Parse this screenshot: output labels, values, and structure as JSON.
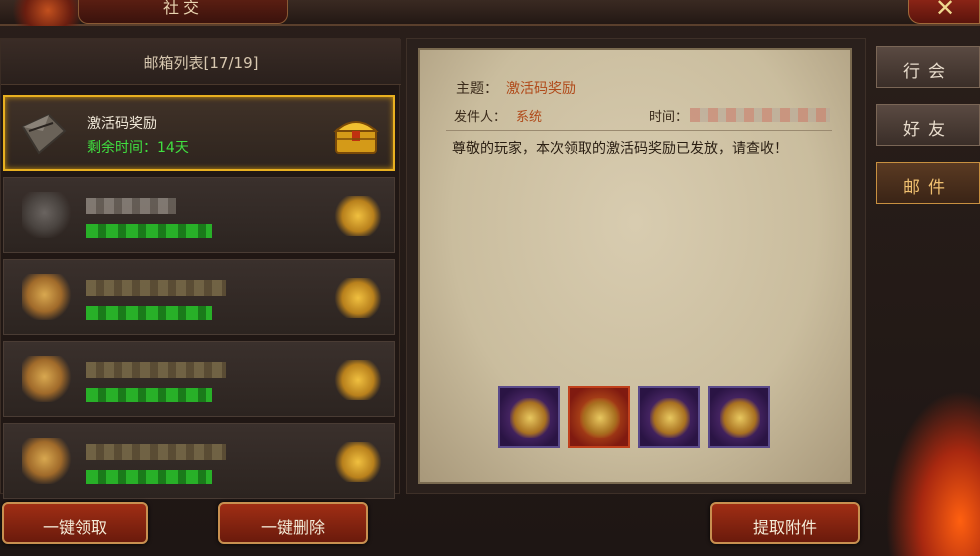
{
  "window": {
    "title": "社交"
  },
  "close_label": "✕",
  "mailbox": {
    "header": "邮箱列表[17/19]",
    "items": [
      {
        "title": "激活码奖励",
        "remaining": "剩余时间：14天"
      }
    ]
  },
  "mail_detail": {
    "subject_label": "主题：",
    "subject": "激活码奖励",
    "sender_label": "发件人：",
    "sender": "系统",
    "time_label": "时间：",
    "body": "尊敬的玩家，本次领取的激活码奖励已发放，请查收！"
  },
  "tabs": [
    {
      "label": "行会"
    },
    {
      "label": "好友"
    },
    {
      "label": "邮件"
    }
  ],
  "buttons": {
    "claim_all": "一键领取",
    "delete_all": "一键删除",
    "take_attachment": "提取附件"
  },
  "colors": {
    "selected_border": "#e8b020",
    "remaining_text": "#40e040",
    "subject_text": "#b04a1a"
  }
}
